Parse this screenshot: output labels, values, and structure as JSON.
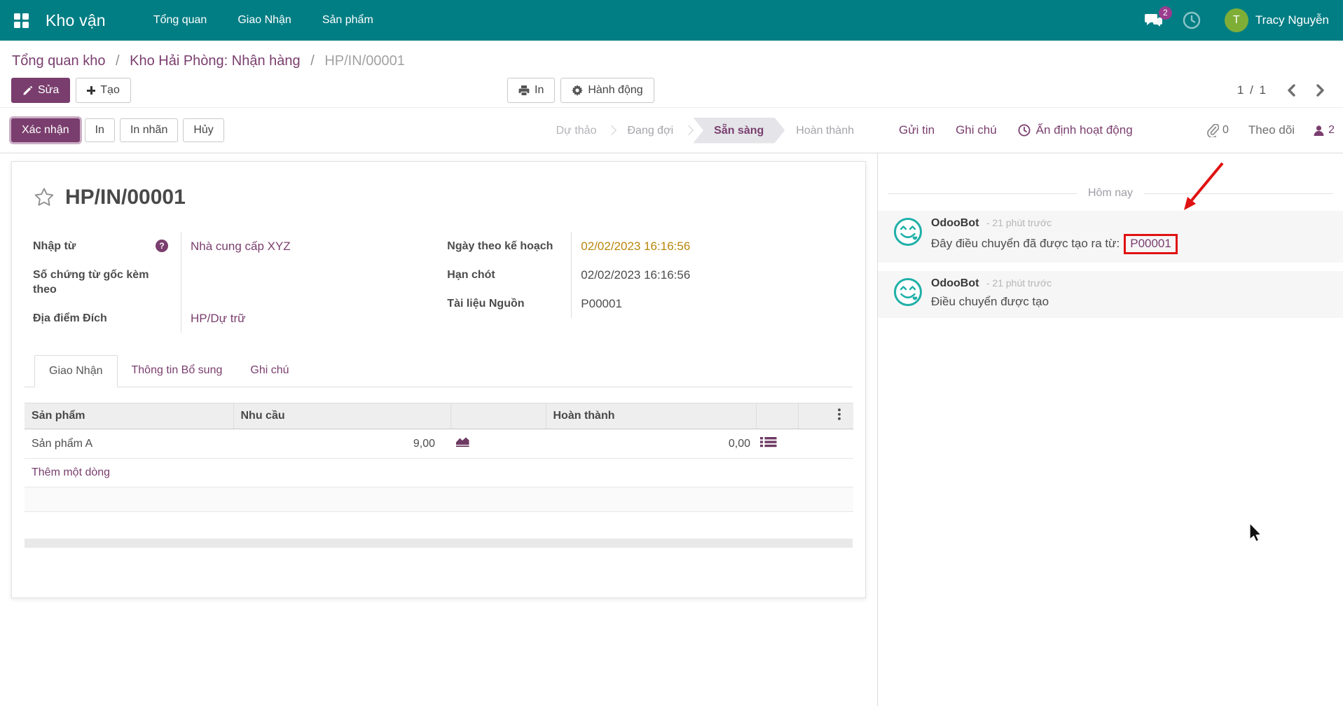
{
  "colors": {
    "navbar_bg": "#017e84",
    "primary_purple": "#7a3e6e",
    "date_highlight": "#b8860b",
    "annotation_red": "#e01212",
    "avatar_green": "#7fae37",
    "badge_purple": "#9a3d8e",
    "odoobot_teal": "#1fb0a8"
  },
  "icons": {
    "help_glyph": "?"
  },
  "navbar": {
    "app_name": "Kho vận",
    "menu": [
      "Tổng quan",
      "Giao Nhận",
      "Sản phẩm"
    ],
    "message_count": "2",
    "user_initial": "T",
    "user_name": "Tracy Nguyễn"
  },
  "breadcrumb": {
    "links": [
      "Tổng quan kho",
      "Kho Hải Phòng: Nhận hàng"
    ],
    "separator": "/",
    "current": "HP/IN/00001"
  },
  "control": {
    "edit": "Sửa",
    "create": "Tạo",
    "print": "In",
    "action": "Hành động",
    "pager": "1 / 1"
  },
  "statusbar": {
    "confirm": "Xác nhận",
    "print": "In",
    "print_label": "In nhãn",
    "cancel": "Hủy",
    "steps": [
      "Dự thảo",
      "Đang đợi",
      "Sẵn sàng",
      "Hoàn thành"
    ],
    "active_step": "Sẵn sàng"
  },
  "chatter": {
    "send": "Gửi tin",
    "log_note": "Ghi chú",
    "schedule_activity": "Ấn định hoạt động",
    "attachment_count": "0",
    "follow": "Theo dõi",
    "follower_count": "2",
    "date_divider": "Hôm nay",
    "messages": [
      {
        "author": "OdooBot",
        "time": "- 21 phút trước",
        "text": "Đây điều chuyển đã được tạo ra từ:",
        "link": "P00001"
      },
      {
        "author": "OdooBot",
        "time": "- 21 phút trước",
        "text": "Điều chuyển được tạo",
        "link": ""
      }
    ]
  },
  "form": {
    "title": "HP/IN/00001",
    "fields_left": [
      {
        "label": "Nhập từ",
        "value": "Nhà cung cấp XYZ"
      },
      {
        "label": "Số chứng từ gốc kèm theo",
        "value": ""
      },
      {
        "label": "Địa điểm Đích",
        "value": "HP/Dự trữ"
      }
    ],
    "fields_right": [
      {
        "label": "Ngày theo kế hoạch",
        "value": "02/02/2023 16:16:56"
      },
      {
        "label": "Hạn chót",
        "value": "02/02/2023 16:16:56"
      },
      {
        "label": "Tài liệu Nguồn",
        "value": "P00001"
      }
    ],
    "tabs": [
      "Giao Nhận",
      "Thông tin Bổ sung",
      "Ghi chú"
    ],
    "active_tab": "Giao Nhận",
    "table": {
      "headers": {
        "product": "Sản phẩm",
        "demand": "Nhu cầu",
        "done": "Hoàn thành"
      },
      "rows": [
        {
          "product": "Sản phẩm A",
          "demand": "9,00",
          "done": "0,00"
        }
      ],
      "add_line": "Thêm một dòng"
    }
  }
}
